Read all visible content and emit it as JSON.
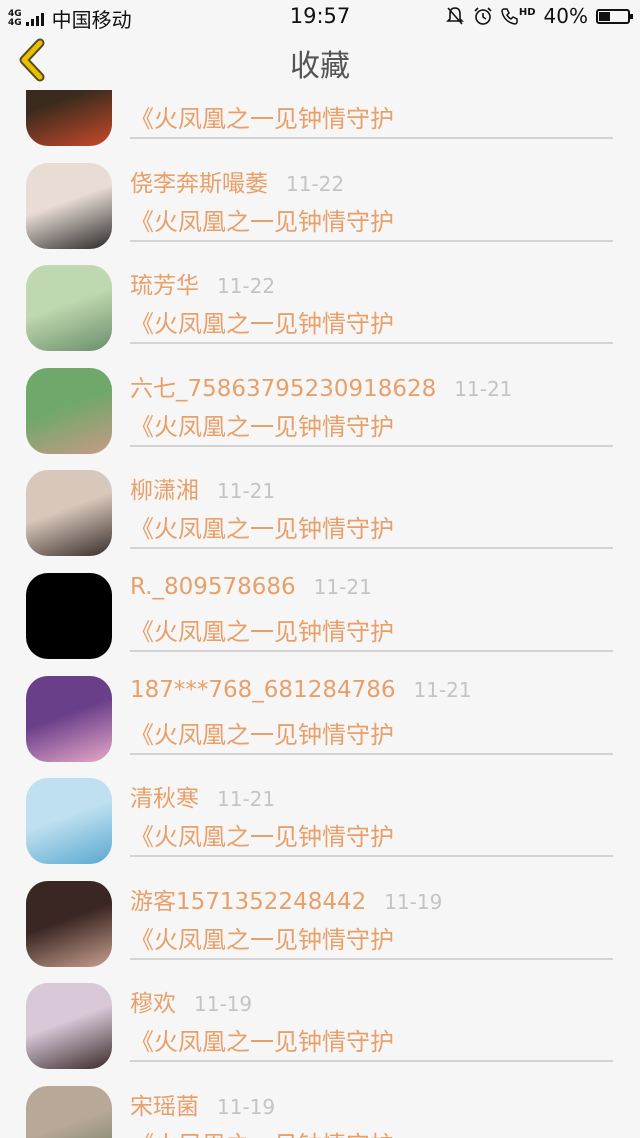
{
  "status_bar": {
    "network": "4G",
    "carrier": "中国移动",
    "time": "19:57",
    "hd_label": "HD",
    "battery": "40%",
    "battery_level": 0.4
  },
  "header": {
    "title": "收藏",
    "back_icon": "chevron-left-icon"
  },
  "favorites": [
    {
      "name": "",
      "date": "",
      "book": "《火凤凰之一见钟情守护",
      "avatar_colors": [
        "#3b2b1e",
        "#c84a2a"
      ]
    },
    {
      "name": "侥李奔斯嘬萎",
      "date": "11-22",
      "book": "《火凤凰之一见钟情守护",
      "avatar_colors": [
        "#e8dcd4",
        "#2a2a2a"
      ]
    },
    {
      "name": "琉芳华",
      "date": "11-22",
      "book": "《火凤凰之一见钟情守护",
      "avatar_colors": [
        "#bfd8b0",
        "#6a8f6a"
      ]
    },
    {
      "name": "六七_75863795230918628",
      "date": "11-21",
      "book": "《火凤凰之一见钟情守护",
      "avatar_colors": [
        "#6fa86a",
        "#c89a86"
      ]
    },
    {
      "name": "柳潇湘",
      "date": "11-21",
      "book": "《火凤凰之一见钟情守护",
      "avatar_colors": [
        "#d8c8bc",
        "#3a2e2a"
      ]
    },
    {
      "name": "R._809578686",
      "date": "11-21",
      "book": "《火凤凰之一见钟情守护",
      "avatar_colors": [
        "#000000",
        "#000000"
      ]
    },
    {
      "name": "187***768_681284786",
      "date": "11-21",
      "book": "《火凤凰之一见钟情守护",
      "avatar_colors": [
        "#6a3f8a",
        "#e6a8c8"
      ]
    },
    {
      "name": "清秋寒",
      "date": "11-21",
      "book": "《火凤凰之一见钟情守护",
      "avatar_colors": [
        "#bfe0f0",
        "#5aa8d0"
      ]
    },
    {
      "name": "游客1571352248442",
      "date": "11-19",
      "book": "《火凤凰之一见钟情守护",
      "avatar_colors": [
        "#3a2622",
        "#c8a090"
      ]
    },
    {
      "name": "穆欢",
      "date": "11-19",
      "book": "《火凤凰之一见钟情守护",
      "avatar_colors": [
        "#d8c8d8",
        "#3a2a2a"
      ]
    },
    {
      "name": "宋瑶菌",
      "date": "11-19",
      "book": "《火凤凰之一见钟情守护",
      "avatar_colors": [
        "#b8a898",
        "#6a7a5a"
      ]
    }
  ],
  "colors": {
    "accent": "#e8a06a",
    "date": "#c4c4c4",
    "background": "#f6f6f6",
    "back_icon": "#e8c000"
  }
}
